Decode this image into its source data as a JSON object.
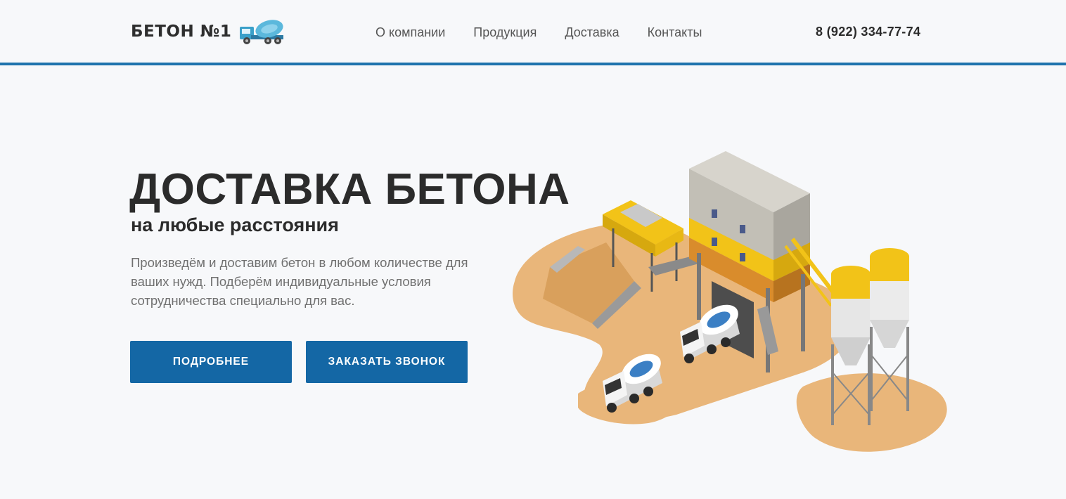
{
  "header": {
    "logo_text": "БЕТОН №1",
    "nav": [
      {
        "label": "О компании"
      },
      {
        "label": "Продукция"
      },
      {
        "label": "Доставка"
      },
      {
        "label": "Контакты"
      }
    ],
    "phone": "8 (922) 334-77-74"
  },
  "hero": {
    "title": "ДОСТАВКА БЕТОНА",
    "subtitle": "на любые расстояния",
    "description": "Произведём и доставим бетон в любом количестве для ваших нужд. Подберём индивидуальные условия сотрудничества специально для вас.",
    "buttons": {
      "more_label": "ПОДРОБНЕЕ",
      "call_label": "ЗАКАЗАТЬ ЗВОНОК"
    }
  },
  "colors": {
    "accent": "#1467a5",
    "header_border": "#1f73ad",
    "background": "#f7f8fa",
    "sand": "#e9b67a",
    "yellow": "#f5c518"
  }
}
